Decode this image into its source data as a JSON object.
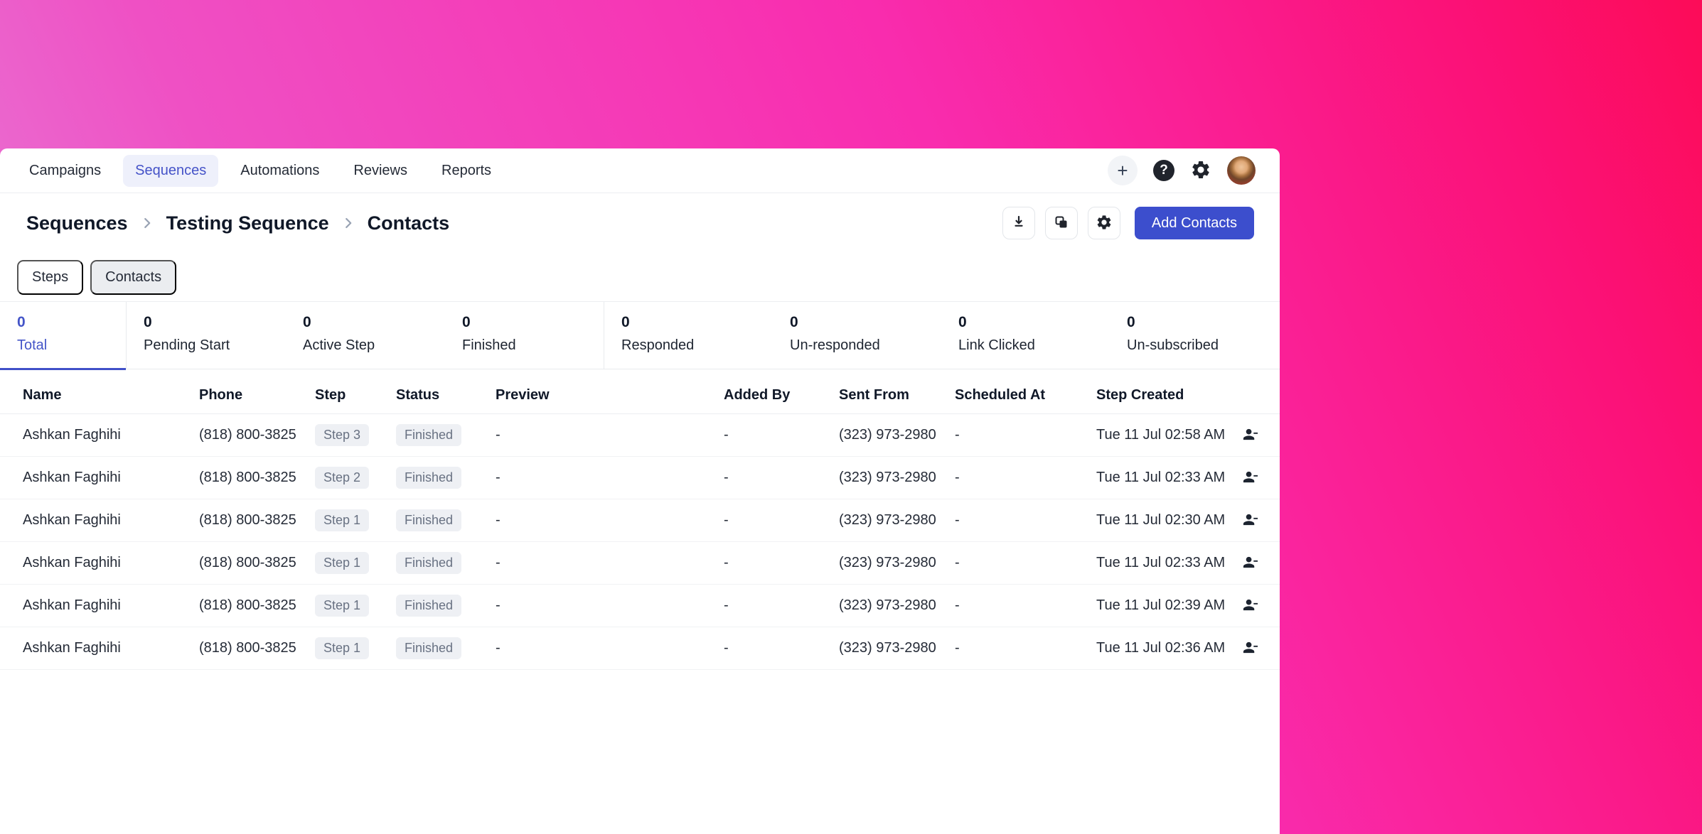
{
  "nav": {
    "items": [
      {
        "label": "Campaigns",
        "active": false
      },
      {
        "label": "Sequences",
        "active": true
      },
      {
        "label": "Automations",
        "active": false
      },
      {
        "label": "Reviews",
        "active": false
      },
      {
        "label": "Reports",
        "active": false
      }
    ],
    "plus_label": "+",
    "help_label": "?"
  },
  "breadcrumb": {
    "items": [
      "Sequences",
      "Testing Sequence",
      "Contacts"
    ]
  },
  "actions": {
    "add_contacts_label": "Add Contacts",
    "icon_buttons": [
      "download-icon",
      "copy-icon",
      "settings-icon"
    ]
  },
  "tabs": [
    {
      "label": "Steps",
      "active": false
    },
    {
      "label": "Contacts",
      "active": true
    }
  ],
  "stats": [
    {
      "value": "0",
      "label": "Total",
      "active": true,
      "divider_after": true
    },
    {
      "value": "0",
      "label": "Pending Start",
      "active": false,
      "divider_after": false
    },
    {
      "value": "0",
      "label": "Active Step",
      "active": false,
      "divider_after": false
    },
    {
      "value": "0",
      "label": "Finished",
      "active": false,
      "divider_after": true
    },
    {
      "value": "0",
      "label": "Responded",
      "active": false,
      "divider_after": false
    },
    {
      "value": "0",
      "label": "Un-responded",
      "active": false,
      "divider_after": false
    },
    {
      "value": "0",
      "label": "Link Clicked",
      "active": false,
      "divider_after": false
    },
    {
      "value": "0",
      "label": "Un-subscribed",
      "active": false,
      "divider_after": false
    }
  ],
  "table": {
    "columns": [
      "Name",
      "Phone",
      "Step",
      "Status",
      "Preview",
      "Added By",
      "Sent From",
      "Scheduled At",
      "Step Created"
    ],
    "rows": [
      {
        "name": "Ashkan Faghihi",
        "phone": "(818) 800-3825",
        "step": "Step 3",
        "status": "Finished",
        "preview": "-",
        "added_by": "-",
        "sent_from": "(323) 973-2980",
        "scheduled_at": "-",
        "step_created": "Tue 11 Jul 02:58 AM"
      },
      {
        "name": "Ashkan Faghihi",
        "phone": "(818) 800-3825",
        "step": "Step 2",
        "status": "Finished",
        "preview": "-",
        "added_by": "-",
        "sent_from": "(323) 973-2980",
        "scheduled_at": "-",
        "step_created": "Tue 11 Jul 02:33 AM"
      },
      {
        "name": "Ashkan Faghihi",
        "phone": "(818) 800-3825",
        "step": "Step 1",
        "status": "Finished",
        "preview": "-",
        "added_by": "-",
        "sent_from": "(323) 973-2980",
        "scheduled_at": "-",
        "step_created": "Tue 11 Jul 02:30 AM"
      },
      {
        "name": "Ashkan Faghihi",
        "phone": "(818) 800-3825",
        "step": "Step 1",
        "status": "Finished",
        "preview": "-",
        "added_by": "-",
        "sent_from": "(323) 973-2980",
        "scheduled_at": "-",
        "step_created": "Tue 11 Jul 02:33 AM"
      },
      {
        "name": "Ashkan Faghihi",
        "phone": "(818) 800-3825",
        "step": "Step 1",
        "status": "Finished",
        "preview": "-",
        "added_by": "-",
        "sent_from": "(323) 973-2980",
        "scheduled_at": "-",
        "step_created": "Tue 11 Jul 02:39 AM"
      },
      {
        "name": "Ashkan Faghihi",
        "phone": "(818) 800-3825",
        "step": "Step 1",
        "status": "Finished",
        "preview": "-",
        "added_by": "-",
        "sent_from": "(323) 973-2980",
        "scheduled_at": "-",
        "step_created": "Tue 11 Jul 02:36 AM"
      }
    ]
  },
  "colors": {
    "accent_indigo": "#3c4ecd",
    "active_nav_text": "#4553c8",
    "active_nav_bg": "#eef0fb",
    "active_stat": "#4455c8",
    "badge_bg": "#eef0f4",
    "badge_text": "#687182",
    "gradient_start": "#e489dc",
    "gradient_mid": "#f92cae",
    "gradient_end": "#fc0a50"
  }
}
